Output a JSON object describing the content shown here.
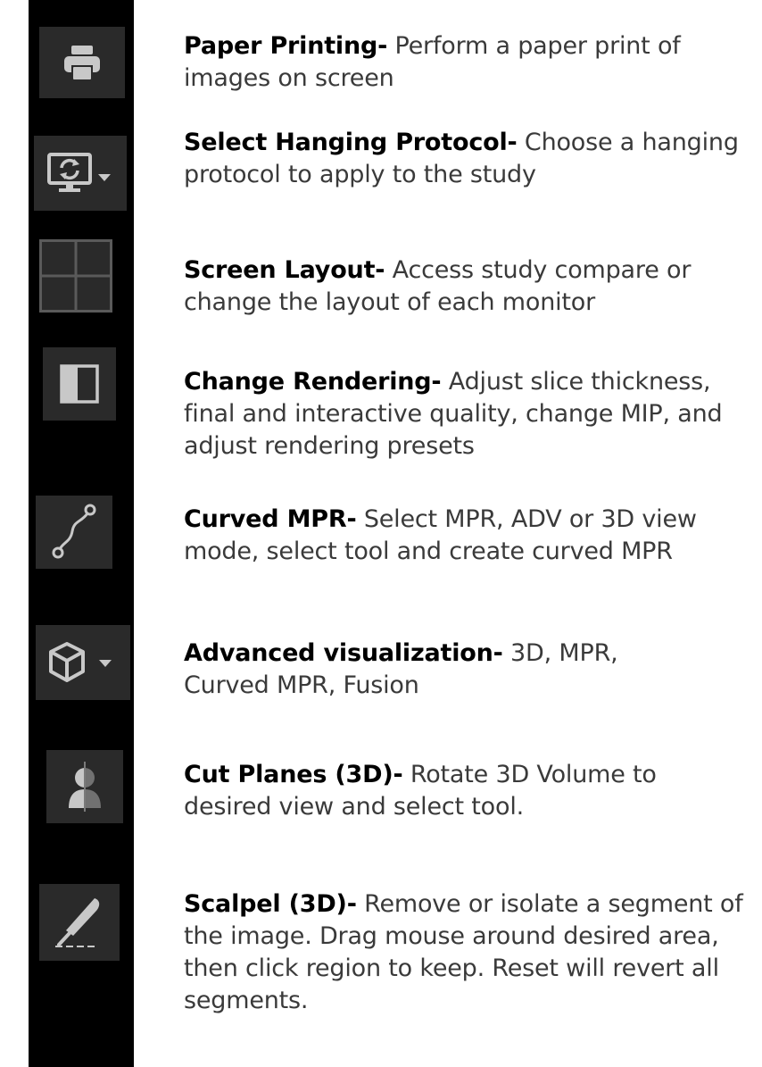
{
  "colors": {
    "strip_background": "#000000",
    "button_background": "#2a2a2a",
    "icon_color": "#c8c8c8",
    "title_color": "#000000",
    "description_color": "#3a3a3a"
  },
  "tools": [
    {
      "icon": "printer-icon",
      "title": "Paper Printing-",
      "description": " Perform a paper print of images on screen"
    },
    {
      "icon": "hanging-protocol-icon",
      "title": "Select Hanging Protocol-",
      "description": " Choose a hanging protocol to apply to the study"
    },
    {
      "icon": "screen-layout-grid-icon",
      "title": "Screen Layout-",
      "description": " Access study compare or change the layout of each monitor"
    },
    {
      "icon": "change-rendering-icon",
      "title": "Change Rendering-",
      "description": " Adjust slice thickness, final and interactive quality, change MIP, and adjust rendering presets"
    },
    {
      "icon": "curved-mpr-icon",
      "title": "Curved MPR-",
      "description": " Select MPR, ADV or 3D view mode, select tool and create curved MPR"
    },
    {
      "icon": "cube-icon",
      "title": "Advanced visualization-",
      "description": " 3D, MPR, Curved MPR, Fusion"
    },
    {
      "icon": "cut-planes-icon",
      "title": "Cut Planes (3D)-",
      "description": " Rotate 3D Volume to desired view and select tool."
    },
    {
      "icon": "scalpel-icon",
      "title": "Scalpel (3D)-",
      "description": " Remove or isolate a segment of the image. Drag mouse around desired area, then click region to keep. Reset will revert all segments."
    }
  ]
}
